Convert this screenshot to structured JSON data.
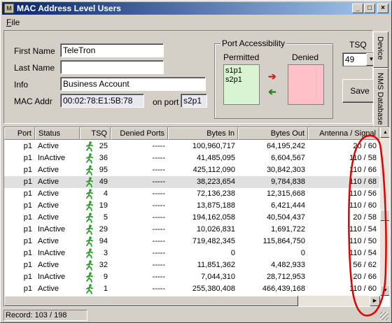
{
  "window": {
    "title": "MAC Address Level Users",
    "menu": [
      "File"
    ],
    "controls": [
      "_",
      "□",
      "×"
    ]
  },
  "form": {
    "first_name": {
      "label": "First Name",
      "value": "TeleTron"
    },
    "last_name": {
      "label": "Last Name",
      "value": ""
    },
    "info": {
      "label": "Info",
      "value": "Business Account"
    },
    "mac_addr": {
      "label": "MAC Addr",
      "value": "00:02:78:E1:5B:78"
    },
    "on_port": {
      "label": "on port",
      "value": "s2p1"
    }
  },
  "port_access": {
    "title": "Port Accessibility",
    "permitted_label": "Permitted",
    "denied_label": "Denied",
    "permitted": [
      "s1p1",
      "s2p1"
    ],
    "denied": []
  },
  "tsq": {
    "label": "TSQ",
    "value": "49"
  },
  "save_label": "Save",
  "side_tabs": [
    "Device",
    "NMS Database"
  ],
  "table": {
    "columns": [
      "Port",
      "Status",
      "TSQ",
      "Denied Ports",
      "Bytes In",
      "Bytes Out",
      "Antenna / Signal"
    ],
    "rows": [
      {
        "port": "p1",
        "status": "Active",
        "tsq": "25",
        "denied": "-----",
        "bytes_in": "100,960,717",
        "bytes_out": "64,195,242",
        "antenna": "20 / 60"
      },
      {
        "port": "p1",
        "status": "InActive",
        "tsq": "36",
        "denied": "-----",
        "bytes_in": "41,485,095",
        "bytes_out": "6,604,567",
        "antenna": "110 / 58"
      },
      {
        "port": "p1",
        "status": "Active",
        "tsq": "95",
        "denied": "-----",
        "bytes_in": "425,112,090",
        "bytes_out": "30,842,303",
        "antenna": "110 / 66"
      },
      {
        "port": "p1",
        "status": "Active",
        "tsq": "49",
        "denied": "-----",
        "bytes_in": "38,223,654",
        "bytes_out": "9,784,838",
        "antenna": "110 / 68"
      },
      {
        "port": "p1",
        "status": "Active",
        "tsq": "4",
        "denied": "-----",
        "bytes_in": "72,136,238",
        "bytes_out": "12,315,668",
        "antenna": "110 / 56"
      },
      {
        "port": "p1",
        "status": "Active",
        "tsq": "19",
        "denied": "-----",
        "bytes_in": "13,875,188",
        "bytes_out": "6,421,444",
        "antenna": "110 / 60"
      },
      {
        "port": "p1",
        "status": "Active",
        "tsq": "5",
        "denied": "-----",
        "bytes_in": "194,162,058",
        "bytes_out": "40,504,437",
        "antenna": "20 / 58"
      },
      {
        "port": "p1",
        "status": "InActive",
        "tsq": "29",
        "denied": "-----",
        "bytes_in": "10,026,831",
        "bytes_out": "1,691,722",
        "antenna": "110 / 54"
      },
      {
        "port": "p1",
        "status": "Active",
        "tsq": "94",
        "denied": "-----",
        "bytes_in": "719,482,345",
        "bytes_out": "115,864,750",
        "antenna": "110 / 50"
      },
      {
        "port": "p1",
        "status": "InActive",
        "tsq": "3",
        "denied": "-----",
        "bytes_in": "0",
        "bytes_out": "0",
        "antenna": "110 / 54"
      },
      {
        "port": "p1",
        "status": "Active",
        "tsq": "32",
        "denied": "-----",
        "bytes_in": "11,851,362",
        "bytes_out": "4,482,933",
        "antenna": "56 / 62"
      },
      {
        "port": "p1",
        "status": "InActive",
        "tsq": "9",
        "denied": "-----",
        "bytes_in": "7,044,310",
        "bytes_out": "28,712,953",
        "antenna": "20 / 66"
      },
      {
        "port": "p1",
        "status": "Active",
        "tsq": "1",
        "denied": "-----",
        "bytes_in": "255,380,408",
        "bytes_out": "466,439,168",
        "antenna": "110 / 60"
      }
    ],
    "selected_row": 3
  },
  "status": {
    "record": "Record:  103 / 198"
  },
  "colors": {
    "titlebar": "#0a246a",
    "permitted_bg": "#d8f4d0",
    "denied_bg": "#ffc0c8",
    "annotation": "#e00000",
    "runner": "#2a9a2a"
  }
}
